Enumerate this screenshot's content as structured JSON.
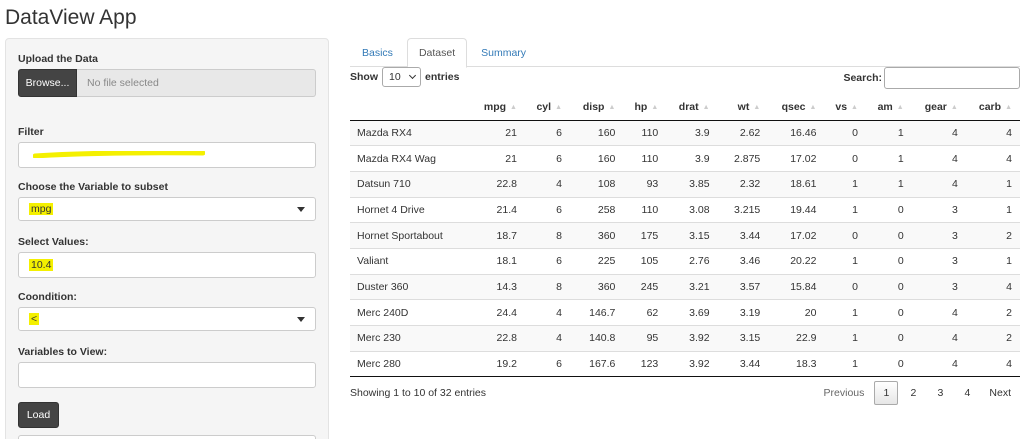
{
  "app": {
    "title": "DataView App"
  },
  "sidebar": {
    "upload": {
      "label": "Upload the Data",
      "browse_label": "Browse...",
      "file_status": "No file selected"
    },
    "filter": {
      "label": "Filter",
      "value": ""
    },
    "variable_subset": {
      "label": "Choose the Variable to subset",
      "selected": "mpg"
    },
    "select_values": {
      "label": "Select Values:",
      "value": "10.4"
    },
    "condition": {
      "label": "Coondition:",
      "selected": "<"
    },
    "variables_view": {
      "label": "Variables to View:",
      "value": ""
    },
    "load_label": "Load",
    "highlight_color": "#f4f000"
  },
  "tabs": [
    {
      "label": "Basics",
      "active": false
    },
    {
      "label": "Dataset",
      "active": true
    },
    {
      "label": "Summary",
      "active": false
    }
  ],
  "table_controls": {
    "show_label": "Show",
    "entries_value": "10",
    "entries_label": "entries",
    "search_label": "Search:"
  },
  "table": {
    "columns": [
      "",
      "mpg",
      "cyl",
      "disp",
      "hp",
      "drat",
      "wt",
      "qsec",
      "vs",
      "am",
      "gear",
      "carb"
    ],
    "rows": [
      [
        "Mazda RX4",
        "21",
        "6",
        "160",
        "110",
        "3.9",
        "2.62",
        "16.46",
        "0",
        "1",
        "4",
        "4"
      ],
      [
        "Mazda RX4 Wag",
        "21",
        "6",
        "160",
        "110",
        "3.9",
        "2.875",
        "17.02",
        "0",
        "1",
        "4",
        "4"
      ],
      [
        "Datsun 710",
        "22.8",
        "4",
        "108",
        "93",
        "3.85",
        "2.32",
        "18.61",
        "1",
        "1",
        "4",
        "1"
      ],
      [
        "Hornet 4 Drive",
        "21.4",
        "6",
        "258",
        "110",
        "3.08",
        "3.215",
        "19.44",
        "1",
        "0",
        "3",
        "1"
      ],
      [
        "Hornet Sportabout",
        "18.7",
        "8",
        "360",
        "175",
        "3.15",
        "3.44",
        "17.02",
        "0",
        "0",
        "3",
        "2"
      ],
      [
        "Valiant",
        "18.1",
        "6",
        "225",
        "105",
        "2.76",
        "3.46",
        "20.22",
        "1",
        "0",
        "3",
        "1"
      ],
      [
        "Duster 360",
        "14.3",
        "8",
        "360",
        "245",
        "3.21",
        "3.57",
        "15.84",
        "0",
        "0",
        "3",
        "4"
      ],
      [
        "Merc 240D",
        "24.4",
        "4",
        "146.7",
        "62",
        "3.69",
        "3.19",
        "20",
        "1",
        "0",
        "4",
        "2"
      ],
      [
        "Merc 230",
        "22.8",
        "4",
        "140.8",
        "95",
        "3.92",
        "3.15",
        "22.9",
        "1",
        "0",
        "4",
        "2"
      ],
      [
        "Merc 280",
        "19.2",
        "6",
        "167.6",
        "123",
        "3.92",
        "3.44",
        "18.3",
        "1",
        "0",
        "4",
        "4"
      ]
    ]
  },
  "footer": {
    "info": "Showing 1 to 10 of 32 entries",
    "pagination": {
      "previous": "Previous",
      "pages": [
        "1",
        "2",
        "3",
        "4"
      ],
      "current": "1",
      "next": "Next"
    }
  }
}
